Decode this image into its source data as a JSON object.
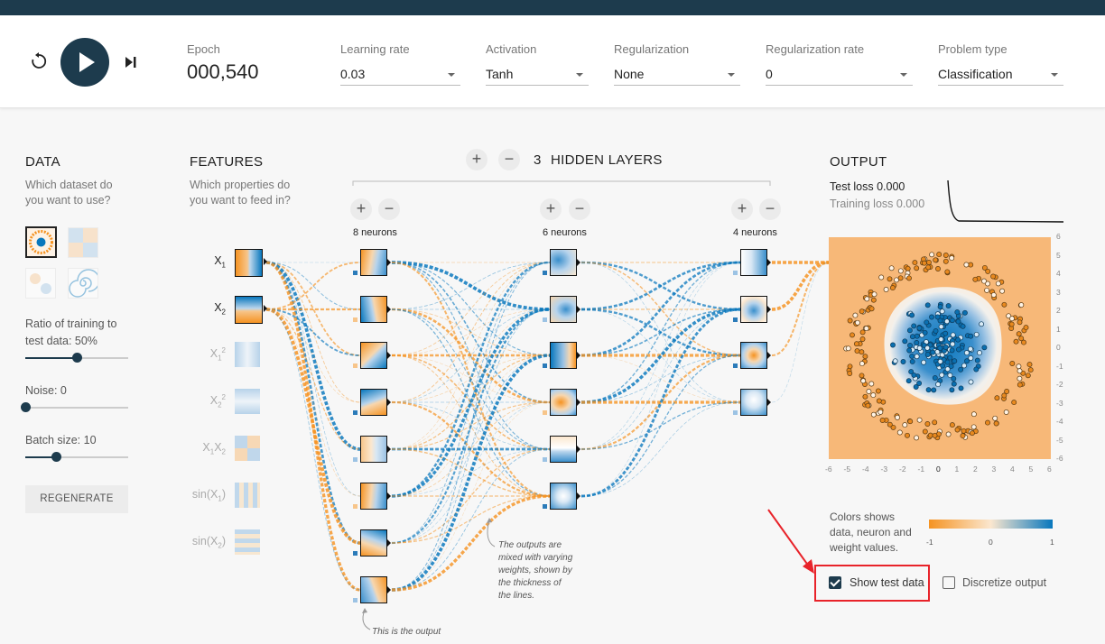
{
  "header": {
    "epoch_label": "Epoch",
    "epoch_value": "000,540",
    "controls": [
      {
        "label": "Learning rate",
        "value": "0.03"
      },
      {
        "label": "Activation",
        "value": "Tanh"
      },
      {
        "label": "Regularization",
        "value": "None"
      },
      {
        "label": "Regularization rate",
        "value": "0"
      },
      {
        "label": "Problem type",
        "value": "Classification"
      }
    ]
  },
  "data_panel": {
    "title": "DATA",
    "subtitle_1": "Which dataset do",
    "subtitle_2": "you want to use?",
    "ratio_label_1": "Ratio of training to",
    "ratio_label_2": "test data:  50%",
    "ratio_value": 0.5,
    "noise_label": "Noise:  0",
    "noise_value": 0,
    "batch_label": "Batch size:  10",
    "batch_value": 0.3,
    "regenerate_label": "REGENERATE"
  },
  "features_panel": {
    "title": "FEATURES",
    "subtitle_1": "Which properties do",
    "subtitle_2": "you want to feed in?",
    "features": [
      {
        "base": "X",
        "sub": "1",
        "sup": "",
        "active": true
      },
      {
        "base": "X",
        "sub": "2",
        "sup": "",
        "active": true
      },
      {
        "base": "X",
        "sub": "1",
        "sup": "2",
        "active": false
      },
      {
        "base": "X",
        "sub": "2",
        "sup": "2",
        "active": false
      },
      {
        "base": "X",
        "sub": "1",
        "sup": "",
        "extra": "X",
        "extra_sub": "2",
        "active": false
      },
      {
        "base": "sin(X",
        "sub": "1",
        "sup": "",
        "close": ")",
        "active": false
      },
      {
        "base": "sin(X",
        "sub": "2",
        "sup": "",
        "close": ")",
        "active": false
      }
    ]
  },
  "network": {
    "layer_count": "3",
    "hidden_layers_label": "HIDDEN LAYERS",
    "layers": [
      {
        "neurons_label": "8 neurons"
      },
      {
        "neurons_label": "6 neurons"
      },
      {
        "neurons_label": "4 neurons"
      }
    ],
    "note_weights_1": "The outputs are",
    "note_weights_2": "mixed with varying",
    "note_weights_3": "weights, shown by",
    "note_weights_4": "the thickness of",
    "note_weights_5": "the lines.",
    "note_output": "This is the output"
  },
  "output_panel": {
    "title": "OUTPUT",
    "test_loss": "Test loss 0.000",
    "training_loss": "Training loss 0.000",
    "axis_ticks": [
      "-6",
      "-5",
      "-4",
      "-3",
      "-2",
      "-1",
      "0",
      "1",
      "2",
      "3",
      "4",
      "5",
      "6"
    ],
    "legend_text_1": "Colors shows",
    "legend_text_2": "data, neuron and",
    "legend_text_3": "weight values.",
    "legend_min": "-1",
    "legend_mid": "0",
    "legend_max": "1",
    "show_test_data_label": "Show test data",
    "discretize_label": "Discretize output",
    "colors": {
      "orange": "#f59322",
      "blue": "#0877bd",
      "dark": "#1d3b4d",
      "highlight": "#e8232a"
    }
  }
}
